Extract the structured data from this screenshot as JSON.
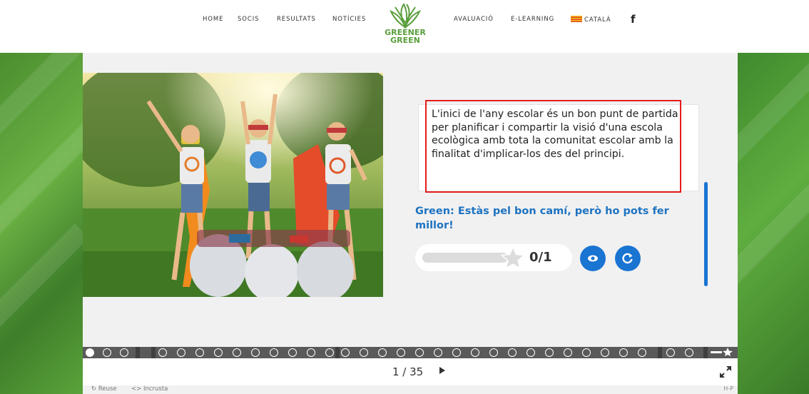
{
  "nav": {
    "home": "HOME",
    "socis": "SOCIS",
    "resultats": "RESULTATS",
    "noticies": "NOTÍCIES",
    "avaluacio": "AVALUACIÓ",
    "elearning": "E-LEARNING",
    "language": "CATALÀ",
    "facebook": "f"
  },
  "logo": {
    "line1": "GREENER",
    "line2": "GREEN",
    "icon": "leaves-logo-icon"
  },
  "slide": {
    "image": "children-superhero-recycling-photo",
    "text": "L'inici de l'any escolar és un bon punt de partida per planificar i compartir la visió d'una escola ecològica amb tota la comunitat escolar amb la finalitat d'implicar-los des del principi.",
    "feedback": "Green: Estàs pel bon camí, però ho pots fer millor!",
    "score": "0/1",
    "score_fraction": 0,
    "show_solution_icon": "eye-icon",
    "retry_icon": "retry-icon"
  },
  "navigation": {
    "current_page": "1 / 35",
    "next_icon": "play-right-icon",
    "fullscreen_icon": "fullscreen-icon",
    "summary_icon": "star-summary-icon"
  },
  "footer": {
    "reuse": "Reuse",
    "embed": "Incrusta",
    "h5p": "H-P"
  },
  "colors": {
    "accent": "#1a74d2",
    "highlight": "#e31d1d",
    "brand_green": "#5a9e3c"
  }
}
